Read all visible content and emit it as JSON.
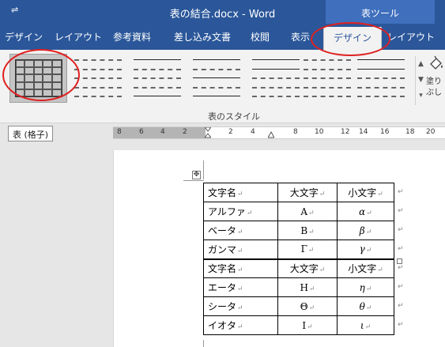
{
  "window": {
    "title": "表の結合.docx - Word",
    "qat_symbol": "⇌",
    "context_group": "表ツール"
  },
  "tabs": [
    {
      "label": "デザイン",
      "active": false
    },
    {
      "label": "レイアウト",
      "active": false
    },
    {
      "label": "参考資料",
      "active": false
    },
    {
      "label": "差し込み文書",
      "active": false
    },
    {
      "label": "校閲",
      "active": false
    },
    {
      "label": "表示",
      "active": false
    },
    {
      "label": "デザイン",
      "active": true
    },
    {
      "label": "レイアウト",
      "active": false
    }
  ],
  "ribbon": {
    "group_label": "表のスタイル",
    "shading_label_1": "塗り",
    "shading_label_2": "ぶし",
    "scroll_up": "▲",
    "scroll_down": "▼",
    "scroll_more": "▾",
    "selected_style_tooltip": "表 (格子)"
  },
  "ruler": {
    "numbers": [
      "8",
      "6",
      "4",
      "2",
      "2",
      "4",
      "8",
      "10",
      "12",
      "14",
      "16",
      "18",
      "20"
    ]
  },
  "document": {
    "move_handle": "✥",
    "paragraph_mark": "↵",
    "table_rows": [
      {
        "name": "文字名",
        "upper": "大文字",
        "lower": "小文字",
        "header": true
      },
      {
        "name": "アルファ",
        "upper": "A",
        "lower": "α",
        "header": false
      },
      {
        "name": "ベータ",
        "upper": "B",
        "lower": "β",
        "header": false
      },
      {
        "name": "ガンマ",
        "upper": "Γ",
        "lower": "γ",
        "header": false
      },
      {
        "name": "文字名",
        "upper": "大文字",
        "lower": "小文字",
        "header": true
      },
      {
        "name": "エータ",
        "upper": "H",
        "lower": "η",
        "header": false
      },
      {
        "name": "シータ",
        "upper": "Θ",
        "lower": "θ",
        "header": false
      },
      {
        "name": "イオタ",
        "upper": "I",
        "lower": "ι",
        "header": false
      }
    ]
  },
  "colors": {
    "brand": "#2b579a",
    "annotation": "#e02020"
  }
}
